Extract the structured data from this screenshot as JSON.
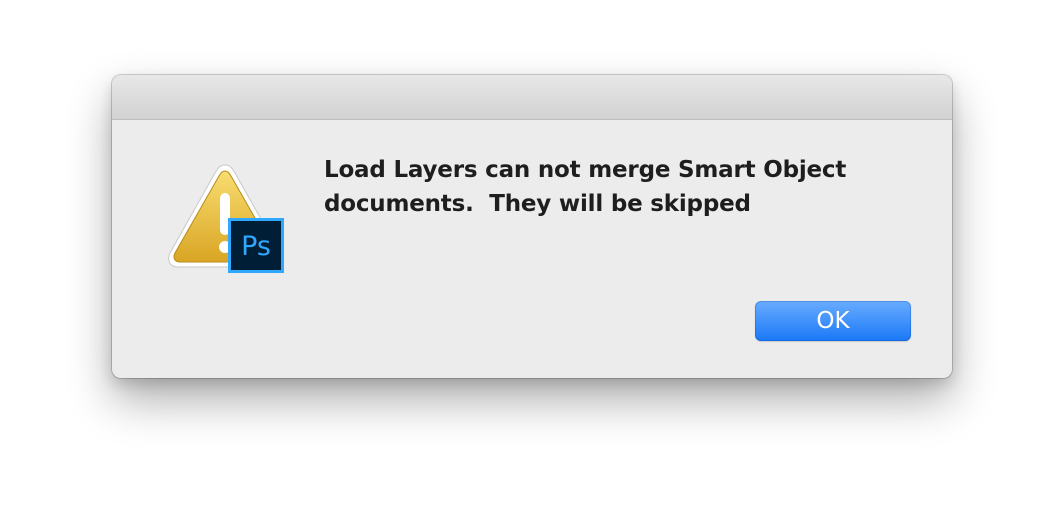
{
  "dialog": {
    "message": "Load Layers can not merge Smart Object documents.  They will be skipped",
    "ok_label": "OK"
  },
  "icon": {
    "warning": "warning-triangle-icon",
    "app_badge": "photoshop-app-icon",
    "app_badge_text": "Ps"
  },
  "colors": {
    "button_blue": "#1a78f7",
    "warning_yellow": "#e3b234",
    "ps_badge_bg": "#001e36",
    "ps_badge_accent": "#31a8ff"
  }
}
